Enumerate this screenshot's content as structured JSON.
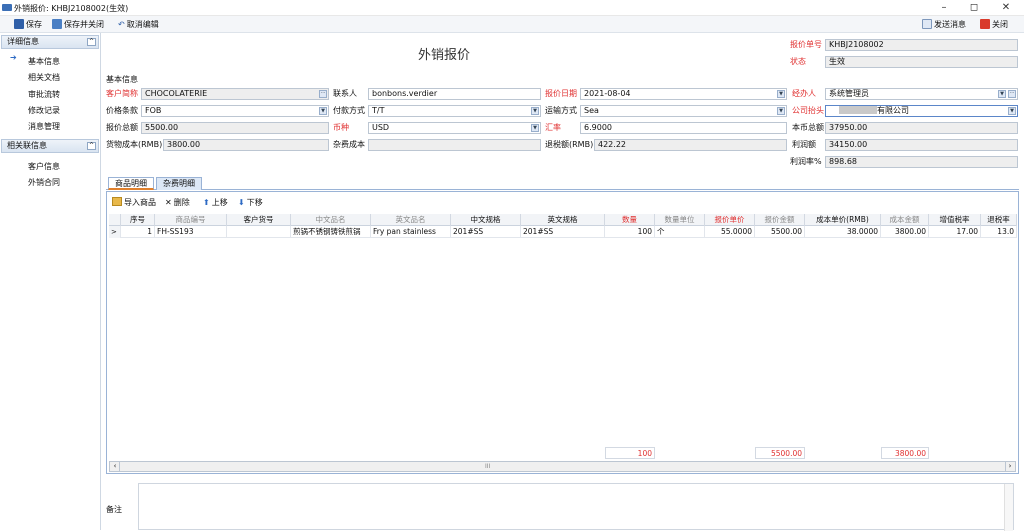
{
  "window": {
    "title": "外销报价: KHBJ2108002(生效)",
    "minimize": "–",
    "maximize": "◻",
    "close": "✕"
  },
  "toolbar": {
    "save": "保存",
    "save_close": "保存并关闭",
    "cancel_edit": "取消编辑",
    "send_message": "发送消息",
    "close": "关闭"
  },
  "sidebar": {
    "detail_header": "详细信息",
    "detail_items": [
      "基本信息",
      "相关文档",
      "审批流转",
      "修改记录",
      "消息管理"
    ],
    "related_header": "相关联信息",
    "related_items": [
      "客户信息",
      "外销合同"
    ],
    "toggle": "^"
  },
  "page_title": "外销报价",
  "header": {
    "quote_no_label": "报价单号",
    "quote_no": "KHBJ2108002",
    "status_label": "状态",
    "status": "生效"
  },
  "section_title": "基本信息",
  "form": {
    "customer_label": "客户简称",
    "customer": "CHOCOLATERIE",
    "contact_label": "联系人",
    "contact": "bonbons.verdier",
    "quote_date_label": "报价日期",
    "quote_date": "2021-08-04",
    "handler_label": "经办人",
    "handler": "系统管理员",
    "price_terms_label": "价格条款",
    "price_terms": "FOB",
    "payment_label": "付款方式",
    "payment": "T/T",
    "transport_label": "运输方式",
    "transport": "Sea",
    "company_label": "公司抬头",
    "company": "有限公司",
    "total_label": "报价总额",
    "total": "5500.00",
    "currency_label": "币种",
    "currency": "USD",
    "rate_label": "汇率",
    "rate": "6.9000",
    "local_total_label": "本币总额",
    "local_total": "37950.00",
    "goods_cost_label": "货物成本(RMB)",
    "goods_cost": "3800.00",
    "misc_cost_label": "杂费成本",
    "misc_cost": "",
    "tax_refund_label": "退税额(RMB)",
    "tax_refund": "422.22",
    "profit_label": "利润额",
    "profit": "34150.00",
    "profit_rate_label": "利润率%",
    "profit_rate": "898.68"
  },
  "tabs": [
    "商品明细",
    "杂费明细"
  ],
  "grid_toolbar": {
    "import": "导入商品",
    "delete": "删除",
    "up": "上移",
    "down": "下移"
  },
  "grid": {
    "columns": [
      "序号",
      "商品编号",
      "客户货号",
      "中文品名",
      "英文品名",
      "中文规格",
      "英文规格",
      "数量",
      "数量单位",
      "报价单价",
      "报价金额",
      "成本单价(RMB)",
      "成本金额",
      "增值税率",
      "退税率"
    ],
    "rows": [
      {
        "indicator": ">",
        "cells": [
          "1",
          "FH-SS193",
          "",
          "煎锅不锈钢铸铁煎锅",
          "Fry pan stainless",
          "201#SS",
          "201#SS",
          "100",
          "个",
          "55.0000",
          "5500.00",
          "38.0000",
          "3800.00",
          "17.00",
          "13.0"
        ]
      }
    ],
    "footer": {
      "qty": "100",
      "amount": "5500.00",
      "cost": "3800.00"
    },
    "scroll_mid": "III"
  },
  "remark_label": "备注",
  "colors": {
    "accent": "#e03030",
    "border": "#9ab3d6",
    "header_bg": "#d9e4f1"
  }
}
